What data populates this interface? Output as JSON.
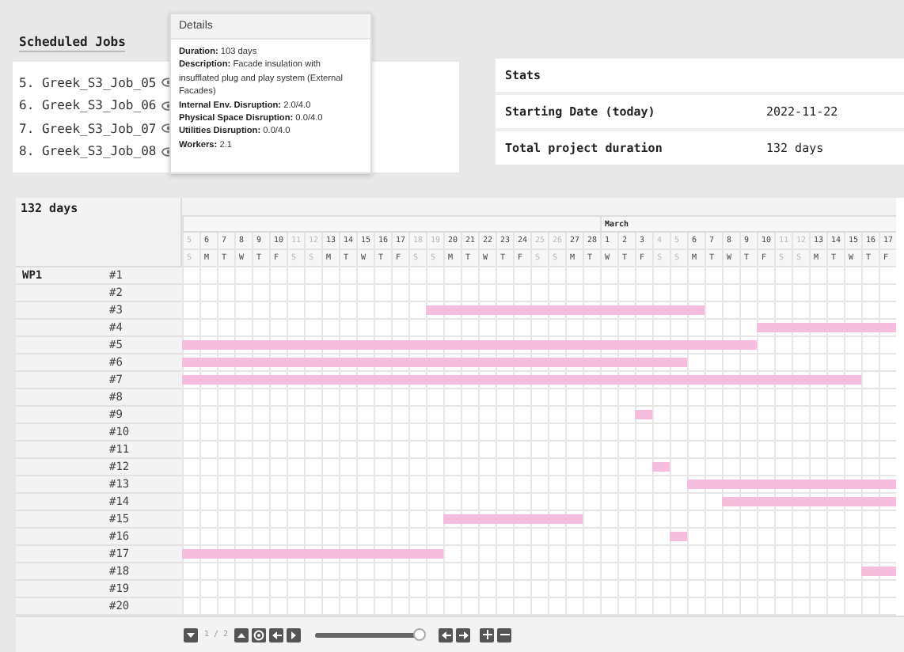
{
  "scheduled_jobs": {
    "title": "Scheduled Jobs",
    "items": [
      {
        "label": "5. Greek_S3_Job_05"
      },
      {
        "label": "6. Greek_S3_Job_06"
      },
      {
        "label": "7. Greek_S3_Job_07"
      },
      {
        "label": "8. Greek_S3_Job_08"
      }
    ]
  },
  "tooltip": {
    "title": "Details",
    "lines": [
      {
        "label": "Duration:",
        "value": "103 days"
      },
      {
        "label": "Description:",
        "value": "Facade insulation with insufflated plug and play system (External Facades)"
      },
      {
        "label": "Internal Env. Disruption:",
        "value": "2.0/4.0"
      },
      {
        "label": "Physical Space Disruption:",
        "value": "0.0/4.0"
      },
      {
        "label": "Utilities Disruption:",
        "value": "0.0/4.0"
      },
      {
        "label": "Workers:",
        "value": "2.1"
      }
    ]
  },
  "stats": {
    "title": "Stats",
    "rows": [
      {
        "label": "Starting Date (today)",
        "value": "2022-11-22"
      },
      {
        "label": "Total project duration",
        "value": "132 days"
      }
    ]
  },
  "gantt": {
    "duration": "132 days",
    "months": [
      {
        "days": [
          {
            "day": "5",
            "weekday": "S",
            "weekend": true
          },
          {
            "day": "6",
            "weekday": "M",
            "weekend": false
          },
          {
            "day": "7",
            "weekday": "T",
            "weekend": false
          },
          {
            "day": "8",
            "weekday": "W",
            "weekend": false
          },
          {
            "day": "9",
            "weekday": "T",
            "weekend": false
          },
          {
            "day": "10",
            "weekday": "F",
            "weekend": false
          },
          {
            "day": "11",
            "weekday": "S",
            "weekend": true
          },
          {
            "day": "12",
            "weekday": "S",
            "weekend": true
          },
          {
            "day": "13",
            "weekday": "M",
            "weekend": false
          },
          {
            "day": "14",
            "weekday": "T",
            "weekend": false
          },
          {
            "day": "15",
            "weekday": "W",
            "weekend": false
          },
          {
            "day": "16",
            "weekday": "T",
            "weekend": false
          },
          {
            "day": "17",
            "weekday": "F",
            "weekend": false
          },
          {
            "day": "18",
            "weekday": "S",
            "weekend": true
          },
          {
            "day": "19",
            "weekday": "S",
            "weekend": true
          },
          {
            "day": "20",
            "weekday": "M",
            "weekend": false
          },
          {
            "day": "21",
            "weekday": "T",
            "weekend": false
          },
          {
            "day": "22",
            "weekday": "W",
            "weekend": false
          },
          {
            "day": "23",
            "weekday": "T",
            "weekend": false
          },
          {
            "day": "24",
            "weekday": "F",
            "weekend": false
          },
          {
            "day": "25",
            "weekday": "S",
            "weekend": true
          },
          {
            "day": "26",
            "weekday": "S",
            "weekend": true
          },
          {
            "day": "27",
            "weekday": "M",
            "weekend": false
          },
          {
            "day": "28",
            "weekday": "T",
            "weekend": false
          }
        ]
      },
      {
        "label": "March",
        "days": [
          {
            "day": "1",
            "weekday": "W",
            "weekend": false
          },
          {
            "day": "2",
            "weekday": "T",
            "weekend": false
          },
          {
            "day": "3",
            "weekday": "F",
            "weekend": false
          },
          {
            "day": "4",
            "weekday": "S",
            "weekend": true
          },
          {
            "day": "5",
            "weekday": "S",
            "weekend": true
          },
          {
            "day": "6",
            "weekday": "M",
            "weekend": false
          },
          {
            "day": "7",
            "weekday": "T",
            "weekend": false
          },
          {
            "day": "8",
            "weekday": "W",
            "weekend": false
          },
          {
            "day": "9",
            "weekday": "T",
            "weekend": false
          },
          {
            "day": "10",
            "weekday": "F",
            "weekend": false
          },
          {
            "day": "11",
            "weekday": "S",
            "weekend": true
          },
          {
            "day": "12",
            "weekday": "S",
            "weekend": true
          },
          {
            "day": "13",
            "weekday": "M",
            "weekend": false
          },
          {
            "day": "14",
            "weekday": "T",
            "weekend": false
          },
          {
            "day": "15",
            "weekday": "W",
            "weekend": false
          },
          {
            "day": "16",
            "weekday": "T",
            "weekend": false
          },
          {
            "day": "17",
            "weekday": "F",
            "weekend": false
          }
        ]
      }
    ],
    "groups": [
      {
        "label": "WP1",
        "tasks": [
          {
            "label": "#1",
            "scheduled": [
              false,
              false,
              false,
              false,
              false,
              false,
              false,
              false,
              false,
              false,
              false,
              false,
              false,
              false,
              false,
              false,
              false,
              false,
              false,
              false,
              false,
              false,
              false,
              false,
              false,
              false,
              false,
              false,
              false,
              false,
              false,
              false,
              false,
              false,
              false,
              false,
              false,
              false,
              false,
              false,
              false
            ]
          },
          {
            "label": "#2",
            "scheduled": [
              false,
              false,
              false,
              false,
              false,
              false,
              false,
              false,
              false,
              false,
              false,
              false,
              false,
              false,
              false,
              false,
              false,
              false,
              false,
              false,
              false,
              false,
              false,
              false,
              false,
              false,
              false,
              false,
              false,
              false,
              false,
              false,
              false,
              false,
              false,
              false,
              false,
              false,
              false,
              false,
              false
            ]
          },
          {
            "label": "#3",
            "scheduled": [
              false,
              false,
              false,
              false,
              false,
              false,
              false,
              false,
              false,
              false,
              false,
              false,
              false,
              false,
              true,
              true,
              true,
              true,
              true,
              true,
              true,
              true,
              true,
              true,
              true,
              true,
              true,
              true,
              true,
              true,
              false,
              false,
              false,
              false,
              false,
              false,
              false,
              false,
              false,
              false,
              false
            ]
          },
          {
            "label": "#4",
            "scheduled": [
              false,
              false,
              false,
              false,
              false,
              false,
              false,
              false,
              false,
              false,
              false,
              false,
              false,
              false,
              false,
              false,
              false,
              false,
              false,
              false,
              false,
              false,
              false,
              false,
              false,
              false,
              false,
              false,
              false,
              false,
              false,
              false,
              false,
              true,
              true,
              true,
              true,
              true,
              true,
              true,
              true
            ]
          },
          {
            "label": "#5",
            "scheduled": [
              true,
              true,
              true,
              true,
              true,
              true,
              true,
              true,
              true,
              true,
              true,
              true,
              true,
              true,
              true,
              true,
              true,
              true,
              true,
              true,
              true,
              true,
              true,
              true,
              true,
              true,
              true,
              true,
              true,
              true,
              true,
              true,
              true,
              false,
              false,
              false,
              false,
              false,
              false,
              false,
              false
            ]
          },
          {
            "label": "#6",
            "scheduled": [
              true,
              true,
              true,
              true,
              true,
              true,
              true,
              true,
              true,
              true,
              true,
              true,
              true,
              true,
              true,
              true,
              true,
              true,
              true,
              true,
              true,
              true,
              true,
              true,
              true,
              true,
              true,
              true,
              true,
              false,
              false,
              false,
              false,
              false,
              false,
              false,
              false,
              false,
              false,
              false,
              false
            ]
          },
          {
            "label": "#7",
            "scheduled": [
              true,
              true,
              true,
              true,
              true,
              true,
              true,
              true,
              true,
              true,
              true,
              true,
              true,
              true,
              true,
              true,
              true,
              true,
              true,
              true,
              true,
              true,
              true,
              true,
              true,
              true,
              true,
              true,
              true,
              true,
              true,
              true,
              true,
              true,
              true,
              true,
              true,
              true,
              true,
              false,
              false
            ]
          },
          {
            "label": "#8",
            "scheduled": [
              false,
              false,
              false,
              false,
              false,
              false,
              false,
              false,
              false,
              false,
              false,
              false,
              false,
              false,
              false,
              false,
              false,
              false,
              false,
              false,
              false,
              false,
              false,
              false,
              false,
              false,
              false,
              false,
              false,
              false,
              false,
              false,
              false,
              false,
              false,
              false,
              false,
              false,
              false,
              false,
              false
            ]
          },
          {
            "label": "#9",
            "scheduled": [
              false,
              false,
              false,
              false,
              false,
              false,
              false,
              false,
              false,
              false,
              false,
              false,
              false,
              false,
              false,
              false,
              false,
              false,
              false,
              false,
              false,
              false,
              false,
              false,
              false,
              false,
              true,
              false,
              false,
              false,
              false,
              false,
              false,
              false,
              false,
              false,
              false,
              false,
              false,
              false,
              false
            ]
          },
          {
            "label": "#10",
            "scheduled": [
              false,
              false,
              false,
              false,
              false,
              false,
              false,
              false,
              false,
              false,
              false,
              false,
              false,
              false,
              false,
              false,
              false,
              false,
              false,
              false,
              false,
              false,
              false,
              false,
              false,
              false,
              false,
              false,
              false,
              false,
              false,
              false,
              false,
              false,
              false,
              false,
              false,
              false,
              false,
              false,
              false
            ]
          },
          {
            "label": "#11",
            "scheduled": [
              false,
              false,
              false,
              false,
              false,
              false,
              false,
              false,
              false,
              false,
              false,
              false,
              false,
              false,
              false,
              false,
              false,
              false,
              false,
              false,
              false,
              false,
              false,
              false,
              false,
              false,
              false,
              false,
              false,
              false,
              false,
              false,
              false,
              false,
              false,
              false,
              false,
              false,
              false,
              false,
              false
            ]
          },
          {
            "label": "#12",
            "scheduled": [
              false,
              false,
              false,
              false,
              false,
              false,
              false,
              false,
              false,
              false,
              false,
              false,
              false,
              false,
              false,
              false,
              false,
              false,
              false,
              false,
              false,
              false,
              false,
              false,
              false,
              false,
              false,
              true,
              false,
              false,
              false,
              false,
              false,
              false,
              false,
              false,
              false,
              false,
              false,
              false,
              false
            ]
          },
          {
            "label": "#13",
            "scheduled": [
              false,
              false,
              false,
              false,
              false,
              false,
              false,
              false,
              false,
              false,
              false,
              false,
              false,
              false,
              false,
              false,
              false,
              false,
              false,
              false,
              false,
              false,
              false,
              false,
              false,
              false,
              false,
              false,
              false,
              true,
              true,
              true,
              true,
              true,
              true,
              true,
              true,
              true,
              true,
              true,
              true
            ]
          },
          {
            "label": "#14",
            "scheduled": [
              false,
              false,
              false,
              false,
              false,
              false,
              false,
              false,
              false,
              false,
              false,
              false,
              false,
              false,
              false,
              false,
              false,
              false,
              false,
              false,
              false,
              false,
              false,
              false,
              false,
              false,
              false,
              false,
              false,
              false,
              false,
              true,
              true,
              true,
              true,
              true,
              true,
              true,
              true,
              true,
              true
            ]
          },
          {
            "label": "#15",
            "scheduled": [
              false,
              false,
              false,
              false,
              false,
              false,
              false,
              false,
              false,
              false,
              false,
              false,
              false,
              false,
              false,
              true,
              true,
              true,
              true,
              true,
              true,
              true,
              true,
              false,
              false,
              false,
              false,
              false,
              false,
              false,
              false,
              false,
              false,
              false,
              false,
              false,
              false,
              false,
              false,
              false,
              false
            ]
          },
          {
            "label": "#16",
            "scheduled": [
              false,
              false,
              false,
              false,
              false,
              false,
              false,
              false,
              false,
              false,
              false,
              false,
              false,
              false,
              false,
              false,
              false,
              false,
              false,
              false,
              false,
              false,
              false,
              false,
              false,
              false,
              false,
              false,
              true,
              false,
              false,
              false,
              false,
              false,
              false,
              false,
              false,
              false,
              false,
              false,
              false
            ]
          },
          {
            "label": "#17",
            "scheduled": [
              true,
              true,
              true,
              true,
              true,
              true,
              true,
              true,
              true,
              true,
              true,
              true,
              true,
              true,
              true,
              false,
              false,
              false,
              false,
              false,
              false,
              false,
              false,
              false,
              false,
              false,
              false,
              false,
              false,
              false,
              false,
              false,
              false,
              false,
              false,
              false,
              false,
              false,
              false,
              false,
              false
            ]
          },
          {
            "label": "#18",
            "scheduled": [
              false,
              false,
              false,
              false,
              false,
              false,
              false,
              false,
              false,
              false,
              false,
              false,
              false,
              false,
              false,
              false,
              false,
              false,
              false,
              false,
              false,
              false,
              false,
              false,
              false,
              false,
              false,
              false,
              false,
              false,
              false,
              false,
              false,
              false,
              false,
              false,
              false,
              false,
              false,
              true,
              true
            ]
          },
          {
            "label": "#19",
            "scheduled": [
              false,
              false,
              false,
              false,
              false,
              false,
              false,
              false,
              false,
              false,
              false,
              false,
              false,
              false,
              false,
              false,
              false,
              false,
              false,
              false,
              false,
              false,
              false,
              false,
              false,
              false,
              false,
              false,
              false,
              false,
              false,
              false,
              false,
              false,
              false,
              false,
              false,
              false,
              false,
              false,
              false
            ]
          },
          {
            "label": "#20",
            "scheduled": [
              false,
              false,
              false,
              false,
              false,
              false,
              false,
              false,
              false,
              false,
              false,
              false,
              false,
              false,
              false,
              false,
              false,
              false,
              false,
              false,
              false,
              false,
              false,
              false,
              false,
              false,
              false,
              false,
              false,
              false,
              false,
              false,
              false,
              false,
              false,
              false,
              false,
              false,
              false,
              false,
              false
            ]
          }
        ]
      }
    ]
  },
  "footer": {
    "page": "1 / 2",
    "zoom": {
      "level": 0.97
    }
  }
}
